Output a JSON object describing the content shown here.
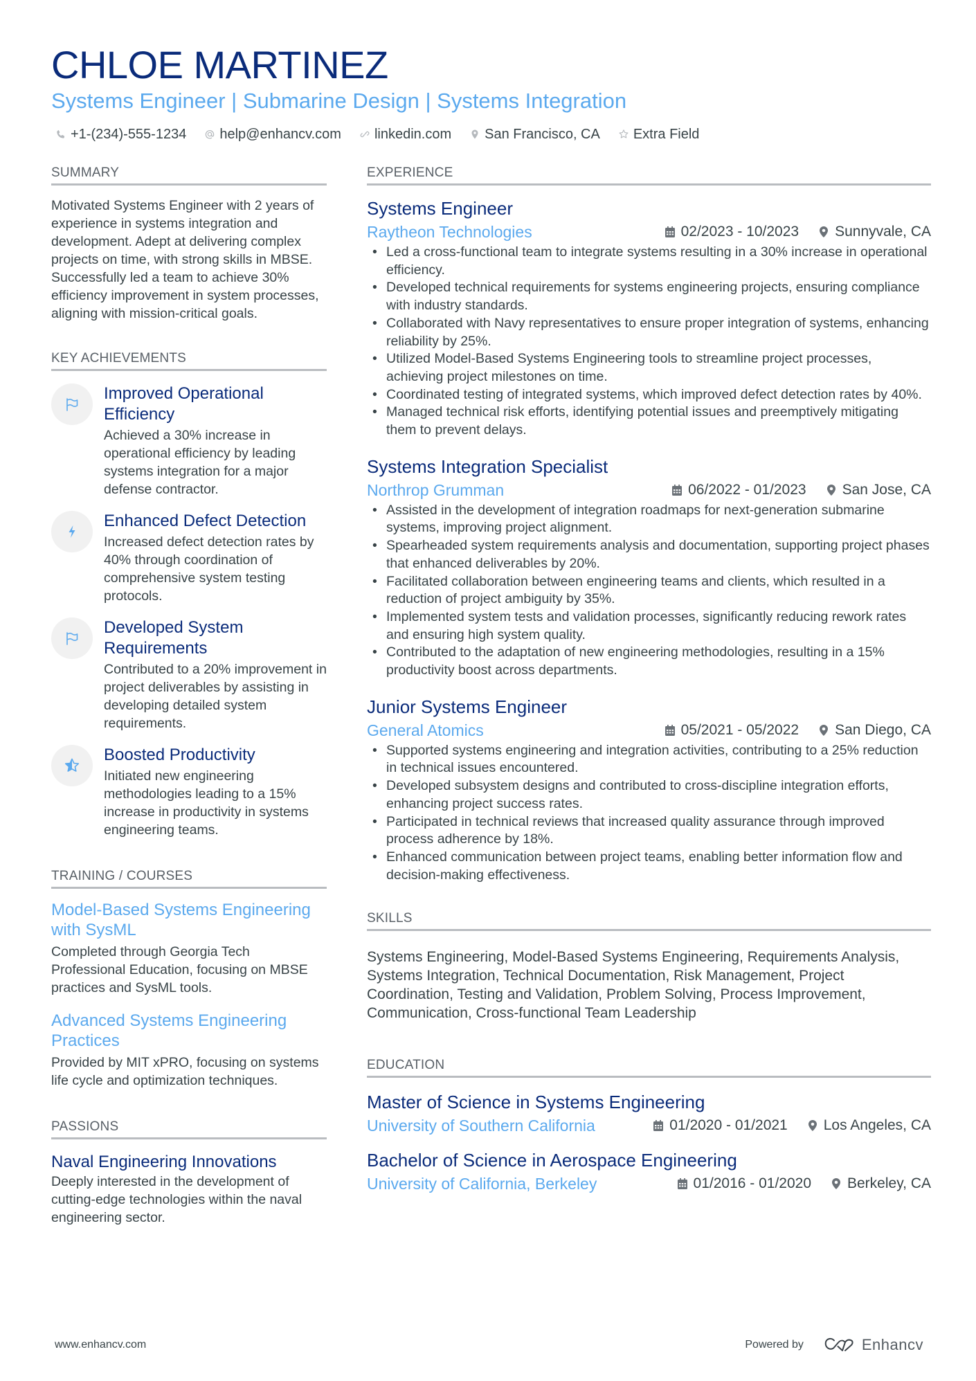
{
  "header": {
    "name": "CHLOE MARTINEZ",
    "subtitle": "Systems Engineer | Submarine Design | Systems Integration",
    "contacts": [
      {
        "icon": "phone-icon",
        "text": "+1-(234)-555-1234"
      },
      {
        "icon": "at-icon",
        "text": "help@enhancv.com"
      },
      {
        "icon": "link-icon",
        "text": "linkedin.com"
      },
      {
        "icon": "location-icon",
        "text": "San Francisco, CA"
      },
      {
        "icon": "star-icon",
        "text": "Extra Field"
      }
    ]
  },
  "summary": {
    "title": "SUMMARY",
    "text": "Motivated Systems Engineer with 2 years of experience in systems integration and development. Adept at delivering complex projects on time, with strong skills in MBSE. Successfully led a team to achieve 30% efficiency improvement in system processes, aligning with mission-critical goals."
  },
  "achievements": {
    "title": "KEY ACHIEVEMENTS",
    "items": [
      {
        "icon": "flag-icon",
        "title": "Improved Operational Efficiency",
        "desc": "Achieved a 30% increase in operational efficiency by leading systems integration for a major defense contractor."
      },
      {
        "icon": "bolt-icon",
        "title": "Enhanced Defect Detection",
        "desc": "Increased defect detection rates by 40% through coordination of comprehensive system testing protocols."
      },
      {
        "icon": "flag-icon",
        "title": "Developed System Requirements",
        "desc": "Contributed to a 20% improvement in project deliverables by assisting in developing detailed system requirements."
      },
      {
        "icon": "star-half-icon",
        "title": "Boosted Productivity",
        "desc": "Initiated new engineering methodologies leading to a 15% increase in productivity in systems engineering teams."
      }
    ]
  },
  "training": {
    "title": "TRAINING / COURSES",
    "items": [
      {
        "title": "Model-Based Systems Engineering with SysML",
        "desc": "Completed through Georgia Tech Professional Education, focusing on MBSE practices and SysML tools."
      },
      {
        "title": "Advanced Systems Engineering Practices",
        "desc": "Provided by MIT xPRO, focusing on systems life cycle and optimization techniques."
      }
    ]
  },
  "passions": {
    "title": "PASSIONS",
    "items": [
      {
        "title": "Naval Engineering Innovations",
        "desc": "Deeply interested in the development of cutting-edge technologies within the naval engineering sector."
      }
    ]
  },
  "experience": {
    "title": "EXPERIENCE",
    "jobs": [
      {
        "title": "Systems Engineer",
        "company": "Raytheon Technologies",
        "dates": "02/2023 - 10/2023",
        "location": "Sunnyvale, CA",
        "bullets": [
          "Led a cross-functional team to integrate systems resulting in a 30% increase in operational efficiency.",
          "Developed technical requirements for systems engineering projects, ensuring compliance with industry standards.",
          "Collaborated with Navy representatives to ensure proper integration of systems, enhancing reliability by 25%.",
          "Utilized Model-Based Systems Engineering tools to streamline project processes, achieving project milestones on time.",
          "Coordinated testing of integrated systems, which improved defect detection rates by 40%.",
          "Managed technical risk efforts, identifying potential issues and preemptively mitigating them to prevent delays."
        ]
      },
      {
        "title": "Systems Integration Specialist",
        "company": "Northrop Grumman",
        "dates": "06/2022 - 01/2023",
        "location": "San Jose, CA",
        "bullets": [
          "Assisted in the development of integration roadmaps for next-generation submarine systems, improving project alignment.",
          "Spearheaded system requirements analysis and documentation, supporting project phases that enhanced deliverables by 20%.",
          "Facilitated collaboration between engineering teams and clients, which resulted in a reduction of project ambiguity by 35%.",
          "Implemented system tests and validation processes, significantly reducing rework rates and ensuring high system quality.",
          "Contributed to the adaptation of new engineering methodologies, resulting in a 15% productivity boost across departments."
        ]
      },
      {
        "title": "Junior Systems Engineer",
        "company": "General Atomics",
        "dates": "05/2021 - 05/2022",
        "location": "San Diego, CA",
        "bullets": [
          "Supported systems engineering and integration activities, contributing to a 25% reduction in technical issues encountered.",
          "Developed subsystem designs and contributed to cross-discipline integration efforts, enhancing project success rates.",
          "Participated in technical reviews that increased quality assurance through improved process adherence by 18%.",
          "Enhanced communication between project teams, enabling better information flow and decision-making effectiveness."
        ]
      }
    ]
  },
  "skills": {
    "title": "SKILLS",
    "text": "Systems Engineering, Model-Based Systems Engineering, Requirements Analysis, Systems Integration, Technical Documentation, Risk Management, Project Coordination, Testing and Validation, Problem Solving, Process Improvement, Communication, Cross-functional Team Leadership"
  },
  "education": {
    "title": "EDUCATION",
    "items": [
      {
        "degree": "Master of Science in Systems Engineering",
        "school": "University of Southern California",
        "dates": "01/2020 - 01/2021",
        "location": "Los Angeles, CA"
      },
      {
        "degree": "Bachelor of Science in Aerospace Engineering",
        "school": "University of California, Berkeley",
        "dates": "01/2016 - 01/2020",
        "location": "Berkeley, CA"
      }
    ]
  },
  "footer": {
    "website": "www.enhancv.com",
    "powered_by": "Powered by",
    "brand": "Enhancv"
  },
  "colors": {
    "name": "#0a2b7a",
    "accent": "#5ba9ee",
    "text": "#384347",
    "section_rule": "#b9bcc0",
    "icon_circle": "#f1f1f1"
  }
}
